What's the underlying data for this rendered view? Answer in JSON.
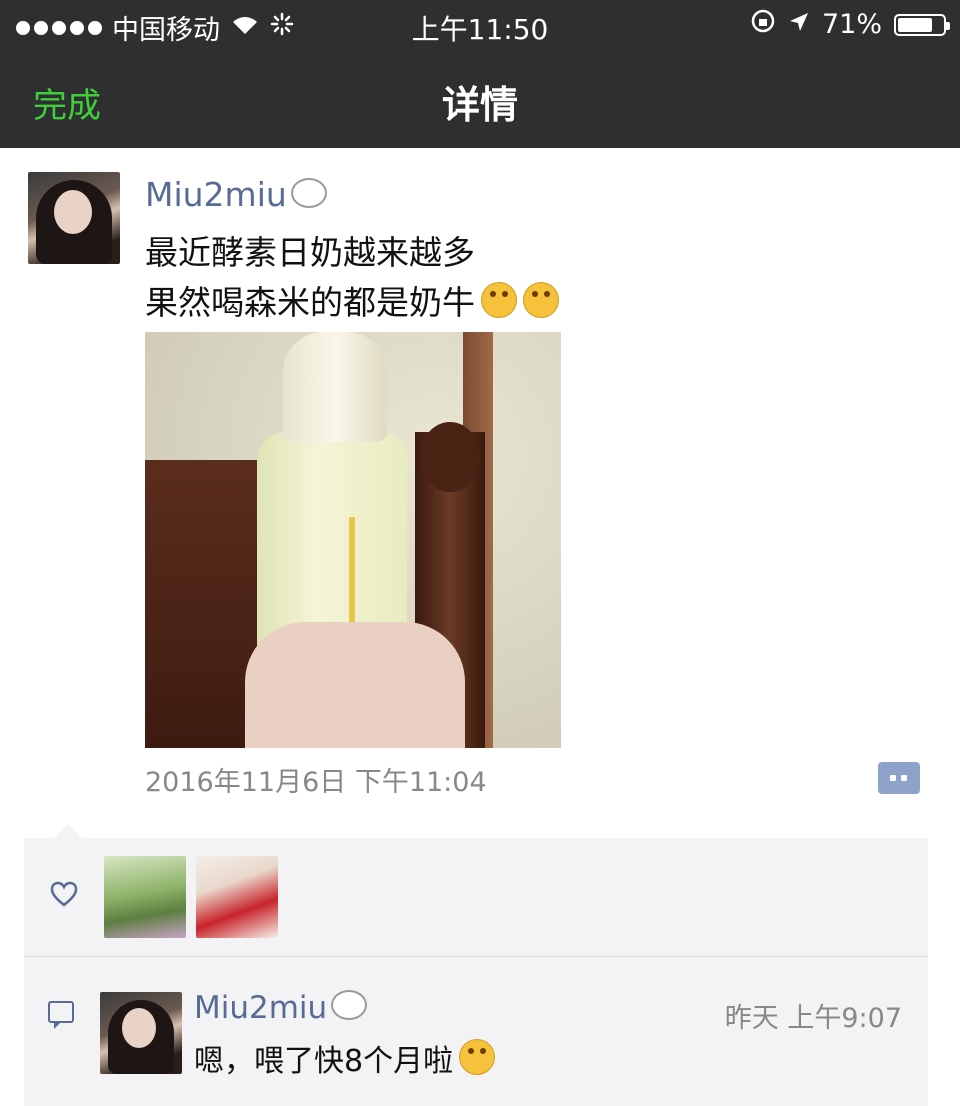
{
  "status_bar": {
    "carrier": "中国移动",
    "time": "上午11:50",
    "battery": "71%"
  },
  "nav": {
    "done_label": "完成",
    "title": "详情"
  },
  "post": {
    "author": "Miu2miu",
    "text_line1": "最近酵素日奶越来越多",
    "text_line2": "果然喝森米的都是奶牛",
    "timestamp": "2016年11月6日 下午11:04"
  },
  "likes": {
    "icon": "heart-icon",
    "count_avatars": 2
  },
  "comments": [
    {
      "author": "Miu2miu",
      "time": "昨天 上午9:07",
      "text": "嗯，喂了快8个月啦"
    }
  ]
}
